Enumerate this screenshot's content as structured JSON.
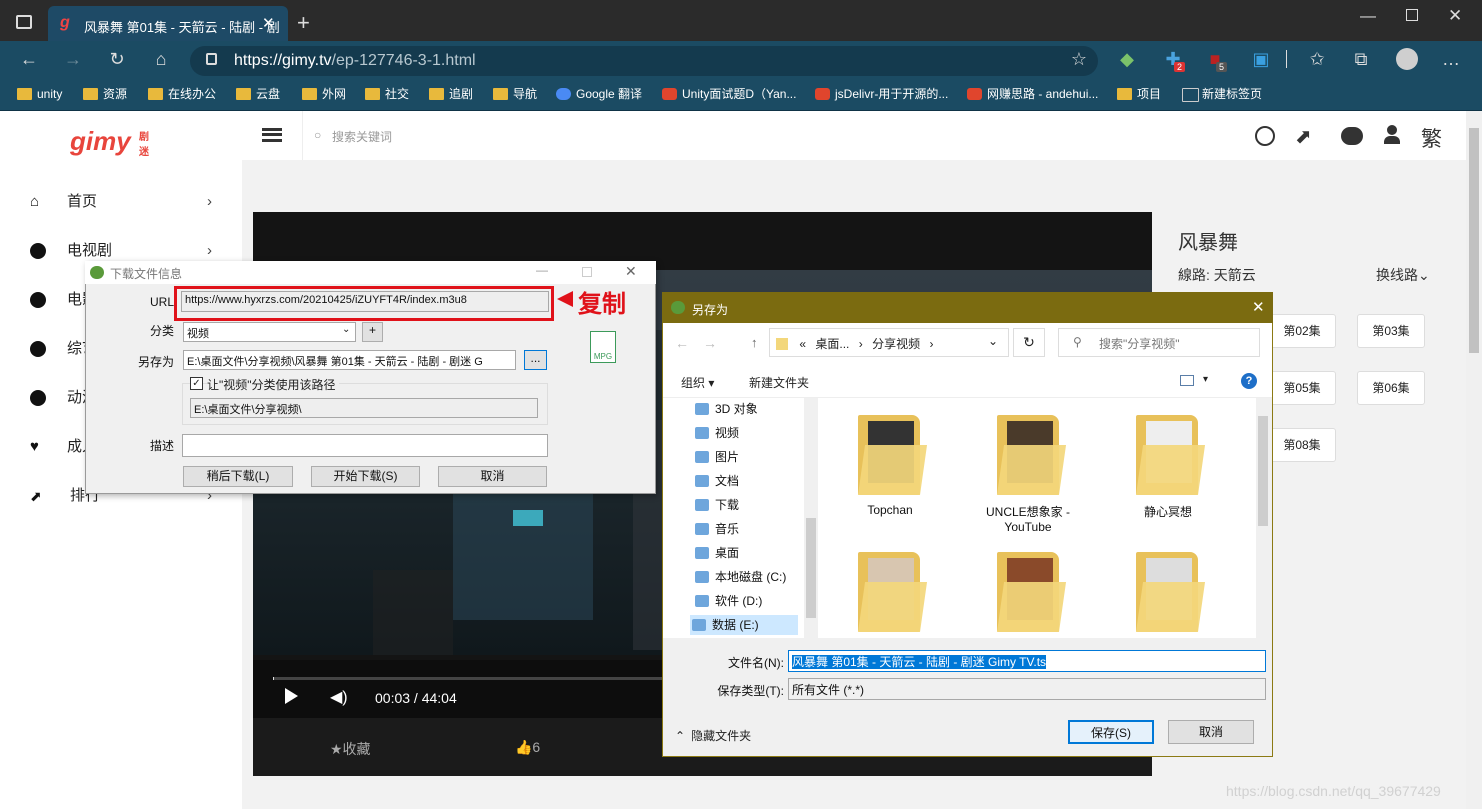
{
  "browser": {
    "tab_title": "风暴舞 第01集 - 天箭云 - 陆剧 - 剧",
    "url_host": "https://gimy.tv",
    "url_path": "/ep-127746-3-1.html",
    "ext_badges": [
      "2",
      "5"
    ],
    "bookmarks": [
      "unity",
      "资源",
      "在线办公",
      "云盘",
      "外网",
      "社交",
      "追剧",
      "导航",
      "Google 翻译",
      "Unity面试题D（Yan...",
      "jsDelivr-用于开源的...",
      "网赚思路 - andehui...",
      "项目",
      "新建标签页"
    ]
  },
  "site": {
    "logo": "gimy",
    "logo_sub": "剧迷",
    "search_placeholder": "搜索关键词",
    "lang_toggle": "繁",
    "nav": [
      {
        "label": "首页",
        "icon": "home-icon"
      },
      {
        "label": "电视剧",
        "icon": "play-circle-icon"
      },
      {
        "label": "电影",
        "icon": "play-circle-icon"
      },
      {
        "label": "综艺",
        "icon": "play-circle-icon"
      },
      {
        "label": "动漫",
        "icon": "play-circle-icon"
      },
      {
        "label": "成人",
        "icon": "heart-icon"
      },
      {
        "label": "排行",
        "icon": "chart-icon"
      }
    ],
    "player": {
      "time": "00:03 / 44:04",
      "progress": 0.001,
      "collect": "★收藏",
      "likes": "👍6"
    },
    "show_title": "风暴舞",
    "line_label": "線路: 天箭云",
    "switch_line": "换线路⌄",
    "episodes": [
      "第02集",
      "第03集",
      "第05集",
      "第06集",
      "第08集"
    ]
  },
  "download_dialog": {
    "title": "下载文件信息",
    "url_label": "URL",
    "url_value": "https://www.hyxrzs.com/20210425/iZUYFT4R/index.m3u8",
    "annotation": "复制",
    "category_label": "分类",
    "category_value": "视频",
    "saveas_label": "另存为",
    "saveas_value": "E:\\桌面文件\\分享视频\\风暴舞 第01集 - 天箭云 - 陆剧 - 剧迷 G",
    "browse": "...",
    "checkbox_label": "让\"视频\"分类使用该路径",
    "path_value": "E:\\桌面文件\\分享视频\\",
    "desc_label": "描述",
    "file_badge": "MPG",
    "buttons": [
      "稍后下载(L)",
      "开始下载(S)",
      "取消"
    ]
  },
  "save_dialog": {
    "title": "另存为",
    "breadcrumb": [
      "«",
      "桌面...",
      "›",
      "分享视频",
      "›"
    ],
    "search_placeholder": "搜索\"分享视频\"",
    "organize": "组织 ▾",
    "new_folder": "新建文件夹",
    "tree": [
      "3D 对象",
      "视频",
      "图片",
      "文档",
      "下载",
      "音乐",
      "桌面",
      "本地磁盘 (C:)",
      "软件 (D:)",
      "数据 (E:)"
    ],
    "folders": [
      "Topchan",
      "UNCLE想象家 - YouTube",
      "静心冥想",
      "",
      "",
      ""
    ],
    "filename_label": "文件名(N):",
    "filename_value": "风暴舞 第01集 - 天箭云 - 陆剧 - 剧迷 Gimy TV.ts",
    "filetype_label": "保存类型(T):",
    "filetype_value": "所有文件 (*.*)",
    "hide_folders": "隐藏文件夹",
    "save": "保存(S)",
    "cancel": "取消"
  },
  "watermark": "https://blog.csdn.net/qq_39677429"
}
